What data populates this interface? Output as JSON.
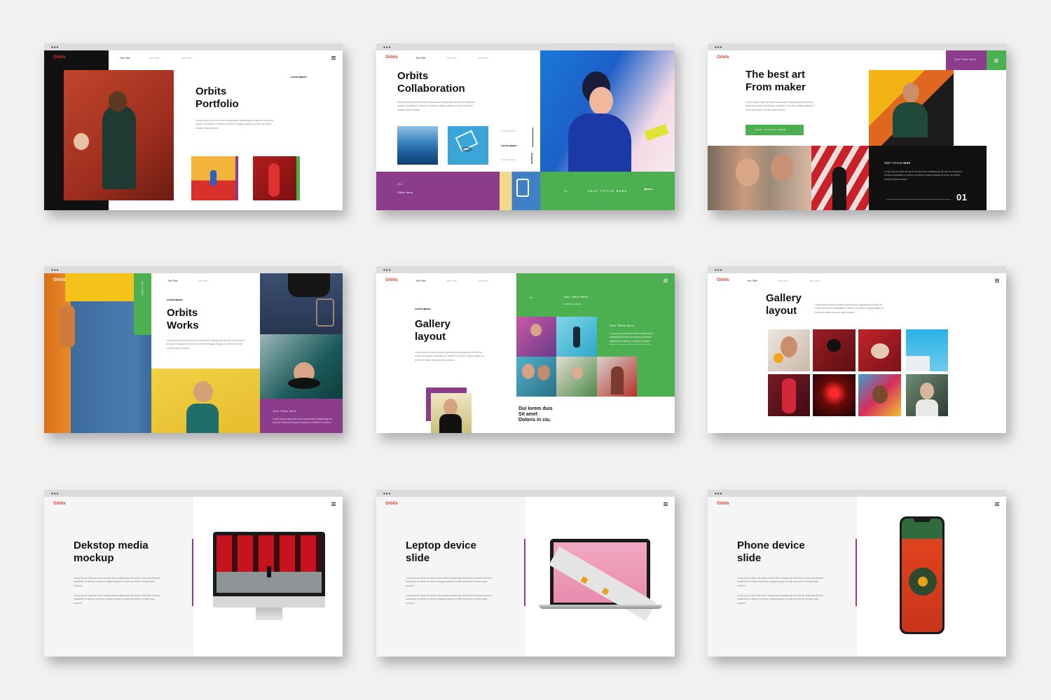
{
  "window": {
    "dots": "•••"
  },
  "colors": {
    "accent_red": "#d53b25",
    "green": "#4caf50",
    "purple": "#8b3c8d",
    "dark": "#111111"
  },
  "lorem": "Lorep ipsum dolor sit amet consectetur adipiscing elit sed do eiusmod tempor incididunt ut labore et dolore magna aliqua ut enim ad minim veniam quis nostrud.",
  "slides": {
    "s1": {
      "brand": "Orbits",
      "nav": [
        "Text Tittle",
        "Text Tittle",
        "Text Tittle"
      ],
      "kicker": "Lorem ipsum",
      "title": "Orbits\nPortfolio"
    },
    "s2": {
      "brand": "Orbits",
      "nav": [
        "Text Tittle",
        "Text Tittle",
        "Text Tittle"
      ],
      "title": "Orbits\nCollaboration",
      "list": [
        "Lorem ipsum",
        "Lorem ipsum",
        "Lorem ipsum"
      ],
      "vertical": "02 ipsum",
      "purple_num": "J11",
      "purple_title": "Tittle here",
      "green_num": "01",
      "green_text": "TEXT TITTLE HERE"
    },
    "s3": {
      "brand": "Orbits",
      "tag": "Text Tittle Here",
      "title": "The best art\nFrom maker",
      "button": "TEXT TITTLE HERE",
      "dark_title": "TEXT TITTLE HERE",
      "number": "01"
    },
    "s4": {
      "brand": "Orbits",
      "nav": [
        "Text Tittle",
        "Text Tittle"
      ],
      "vertical": "Text Tittle",
      "kicker": "Lorem ipsum",
      "title": "Orbits\nWorks",
      "purple_title": "Text Tittle Here"
    },
    "s5": {
      "brand": "Orbits",
      "nav": [
        "Text Tittle",
        "Text Tittle",
        "Text Tittle"
      ],
      "kicker": "Lorem ipsum",
      "title": "Gallery\nlayout",
      "green_num": "01",
      "green_title": "Text Tittle Here",
      "green_sub": "Lorem ipsum",
      "green_title2": "Text Tittle Here",
      "caption": "Dui lorem duis\nSit amet\nDoloris in ciu."
    },
    "s6": {
      "brand": "Orbits",
      "nav": [
        "Text Tittle",
        "Text Tittle",
        "Text Tittle"
      ],
      "title": "Gallery\nlayout"
    },
    "s7": {
      "brand": "Orbits",
      "title": "Dekstop media\nmockup"
    },
    "s8": {
      "brand": "Orbits",
      "title": "Leptop device\nslide"
    },
    "s9": {
      "brand": "Orbits",
      "title": "Phone device\nslide"
    }
  }
}
